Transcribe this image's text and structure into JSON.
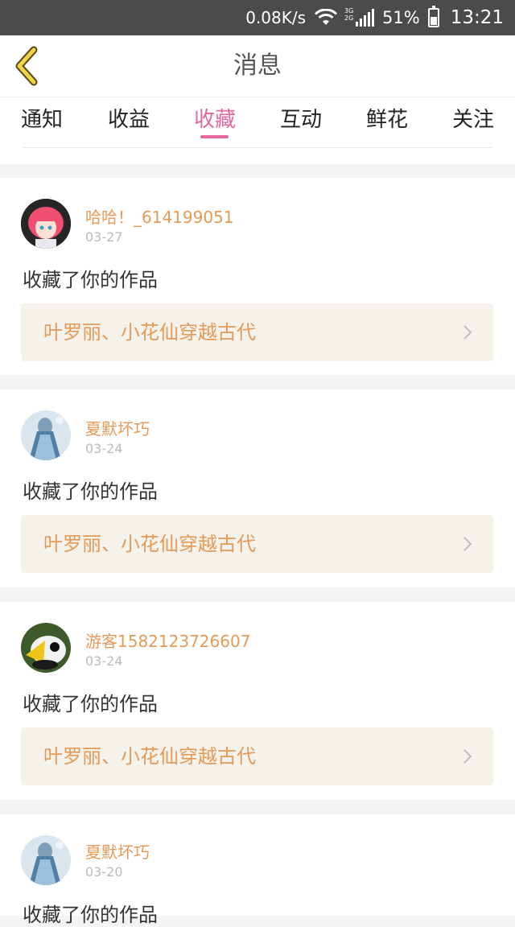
{
  "status_bar": {
    "speed": "0.08K/s",
    "network": "3G 2G",
    "battery": "51%",
    "time": "13:21",
    "battery_level": 0.51
  },
  "header": {
    "title": "消息",
    "back_icon": "chevron-left-icon"
  },
  "tabs": [
    {
      "label": "通知",
      "active": false
    },
    {
      "label": "收益",
      "active": false
    },
    {
      "label": "收藏",
      "active": true
    },
    {
      "label": "互动",
      "active": false
    },
    {
      "label": "鲜花",
      "active": false
    },
    {
      "label": "关注",
      "active": false
    }
  ],
  "colors": {
    "accent": "#e5689a",
    "name_color": "#e59a57",
    "link_bg": "#f4f2eb"
  },
  "messages": [
    {
      "user": "哈哈！_614199051",
      "date": "03-27",
      "action": "收藏了你的作品",
      "work": "叶罗丽、小花仙穿越古代"
    },
    {
      "user": "夏默坏巧",
      "date": "03-24",
      "action": "收藏了你的作品",
      "work": "叶罗丽、小花仙穿越古代"
    },
    {
      "user": "游客1582123726607",
      "date": "03-24",
      "action": "收藏了你的作品",
      "work": "叶罗丽、小花仙穿越古代"
    },
    {
      "user": "夏默坏巧",
      "date": "03-20",
      "action": "收藏了你的作品"
    }
  ]
}
